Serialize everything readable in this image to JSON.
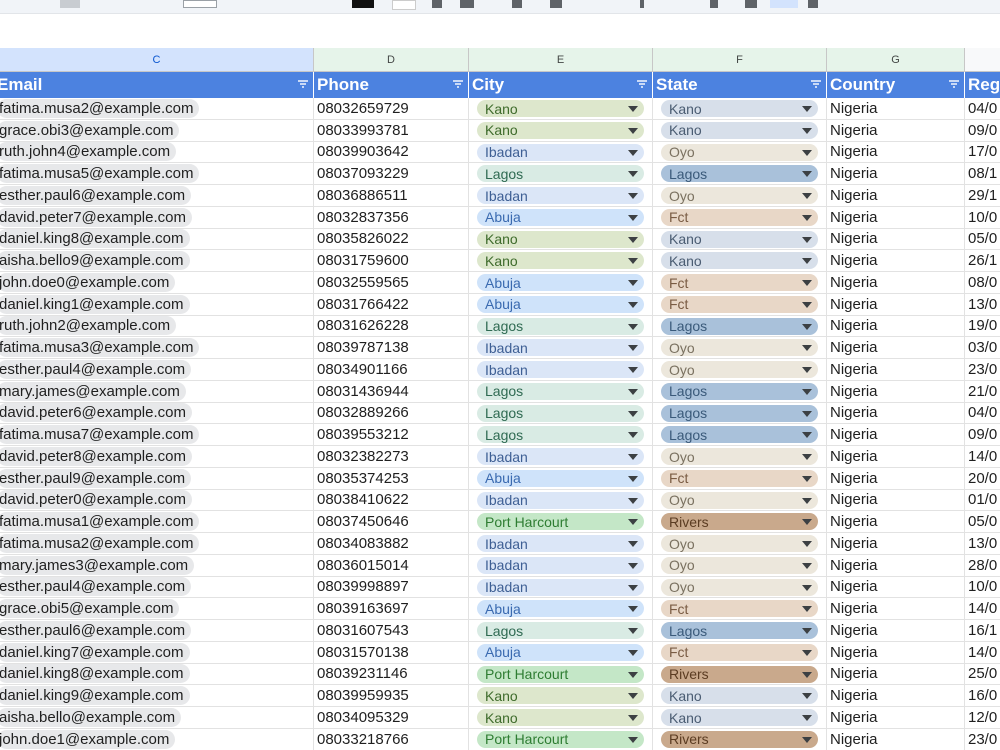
{
  "columns": [
    {
      "letter": "C",
      "header": "Email"
    },
    {
      "letter": "D",
      "header": "Phone"
    },
    {
      "letter": "E",
      "header": "City"
    },
    {
      "letter": "F",
      "header": "State"
    },
    {
      "letter": "G",
      "header": "Country"
    },
    {
      "letter": "",
      "header": "Reg"
    }
  ],
  "colors": {
    "header_blue": "#4c82e0",
    "chips": {
      "Kano": {
        "bg": "#dde7cc",
        "fg": "#3e6b2b"
      },
      "Ibadan": {
        "bg": "#dbe6f7",
        "fg": "#3e5f94"
      },
      "Lagos": {
        "bg": "#d9ebe4",
        "fg": "#2f6a52"
      },
      "Abuja": {
        "bg": "#cfe3fa",
        "fg": "#3a6ab0"
      },
      "Port Harcourt": {
        "bg": "#c4e7c7",
        "fg": "#2e7d32"
      },
      "state_Kano": {
        "bg": "#d7dfea",
        "fg": "#4a5c72"
      },
      "state_Oyo": {
        "bg": "#ece7dc",
        "fg": "#7a7160"
      },
      "state_Lagos": {
        "bg": "#a9c1da",
        "fg": "#3a5a7a"
      },
      "state_Fct": {
        "bg": "#e8d7c7",
        "fg": "#7a5c44"
      },
      "state_Rivers": {
        "bg": "#c9a98c",
        "fg": "#5b3c22"
      }
    }
  },
  "rows": [
    {
      "email": "fatima.musa2@example.com",
      "phone": "08032659729",
      "city": "Kano",
      "state": "Kano",
      "country": "Nigeria",
      "reg": "04/0"
    },
    {
      "email": "grace.obi3@example.com",
      "phone": "08033993781",
      "city": "Kano",
      "state": "Kano",
      "country": "Nigeria",
      "reg": "09/0"
    },
    {
      "email": "ruth.john4@example.com",
      "phone": "08039903642",
      "city": "Ibadan",
      "state": "Oyo",
      "country": "Nigeria",
      "reg": "17/0"
    },
    {
      "email": "fatima.musa5@example.com",
      "phone": "08037093229",
      "city": "Lagos",
      "state": "Lagos",
      "country": "Nigeria",
      "reg": "08/1"
    },
    {
      "email": "esther.paul6@example.com",
      "phone": "08036886511",
      "city": "Ibadan",
      "state": "Oyo",
      "country": "Nigeria",
      "reg": "29/1"
    },
    {
      "email": "david.peter7@example.com",
      "phone": "08032837356",
      "city": "Abuja",
      "state": "Fct",
      "country": "Nigeria",
      "reg": "10/0"
    },
    {
      "email": "daniel.king8@example.com",
      "phone": "08035826022",
      "city": "Kano",
      "state": "Kano",
      "country": "Nigeria",
      "reg": "05/0"
    },
    {
      "email": "aisha.bello9@example.com",
      "phone": "08031759600",
      "city": "Kano",
      "state": "Kano",
      "country": "Nigeria",
      "reg": "26/1"
    },
    {
      "email": "john.doe0@example.com",
      "phone": "08032559565",
      "city": "Abuja",
      "state": "Fct",
      "country": "Nigeria",
      "reg": "08/0"
    },
    {
      "email": "daniel.king1@example.com",
      "phone": "08031766422",
      "city": "Abuja",
      "state": "Fct",
      "country": "Nigeria",
      "reg": "13/0"
    },
    {
      "email": "ruth.john2@example.com",
      "phone": "08031626228",
      "city": "Lagos",
      "state": "Lagos",
      "country": "Nigeria",
      "reg": "19/0"
    },
    {
      "email": "fatima.musa3@example.com",
      "phone": "08039787138",
      "city": "Ibadan",
      "state": "Oyo",
      "country": "Nigeria",
      "reg": "03/0"
    },
    {
      "email": "esther.paul4@example.com",
      "phone": "08034901166",
      "city": "Ibadan",
      "state": "Oyo",
      "country": "Nigeria",
      "reg": "23/0"
    },
    {
      "email": "mary.james@example.com",
      "phone": "08031436944",
      "city": "Lagos",
      "state": "Lagos",
      "country": "Nigeria",
      "reg": "21/0"
    },
    {
      "email": "david.peter6@example.com",
      "phone": "08032889266",
      "city": "Lagos",
      "state": "Lagos",
      "country": "Nigeria",
      "reg": "04/0"
    },
    {
      "email": "fatima.musa7@example.com",
      "phone": "08039553212",
      "city": "Lagos",
      "state": "Lagos",
      "country": "Nigeria",
      "reg": "09/0"
    },
    {
      "email": "david.peter8@example.com",
      "phone": "08032382273",
      "city": "Ibadan",
      "state": "Oyo",
      "country": "Nigeria",
      "reg": "14/0"
    },
    {
      "email": "esther.paul9@example.com",
      "phone": "08035374253",
      "city": "Abuja",
      "state": "Fct",
      "country": "Nigeria",
      "reg": "20/0"
    },
    {
      "email": "david.peter0@example.com",
      "phone": "08038410622",
      "city": "Ibadan",
      "state": "Oyo",
      "country": "Nigeria",
      "reg": "01/0"
    },
    {
      "email": "fatima.musa1@example.com",
      "phone": "08037450646",
      "city": "Port Harcourt",
      "state": "Rivers",
      "country": "Nigeria",
      "reg": "05/0"
    },
    {
      "email": "fatima.musa2@example.com",
      "phone": "08034083882",
      "city": "Ibadan",
      "state": "Oyo",
      "country": "Nigeria",
      "reg": "13/0"
    },
    {
      "email": "mary.james3@example.com",
      "phone": "08036015014",
      "city": "Ibadan",
      "state": "Oyo",
      "country": "Nigeria",
      "reg": "28/0"
    },
    {
      "email": "esther.paul4@example.com",
      "phone": "08039998897",
      "city": "Ibadan",
      "state": "Oyo",
      "country": "Nigeria",
      "reg": "10/0"
    },
    {
      "email": "grace.obi5@example.com",
      "phone": "08039163697",
      "city": "Abuja",
      "state": "Fct",
      "country": "Nigeria",
      "reg": "14/0"
    },
    {
      "email": "esther.paul6@example.com",
      "phone": "08031607543",
      "city": "Lagos",
      "state": "Lagos",
      "country": "Nigeria",
      "reg": "16/1"
    },
    {
      "email": "daniel.king7@example.com",
      "phone": "08031570138",
      "city": "Abuja",
      "state": "Fct",
      "country": "Nigeria",
      "reg": "14/0"
    },
    {
      "email": "daniel.king8@example.com",
      "phone": "08039231146",
      "city": "Port Harcourt",
      "state": "Rivers",
      "country": "Nigeria",
      "reg": "25/0"
    },
    {
      "email": "daniel.king9@example.com",
      "phone": "08039959935",
      "city": "Kano",
      "state": "Kano",
      "country": "Nigeria",
      "reg": "16/0"
    },
    {
      "email": "aisha.bello@example.com",
      "phone": "08034095329",
      "city": "Kano",
      "state": "Kano",
      "country": "Nigeria",
      "reg": "12/0"
    },
    {
      "email": "john.doe1@example.com",
      "phone": "08033218766",
      "city": "Port Harcourt",
      "state": "Rivers",
      "country": "Nigeria",
      "reg": "23/0"
    }
  ]
}
